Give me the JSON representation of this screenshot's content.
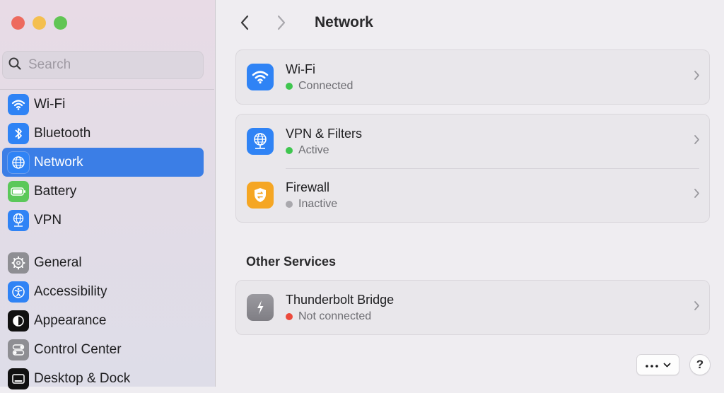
{
  "search": {
    "placeholder": "Search"
  },
  "sidebar": {
    "items": [
      {
        "label": "Wi-Fi"
      },
      {
        "label": "Bluetooth"
      },
      {
        "label": "Network"
      },
      {
        "label": "Battery"
      },
      {
        "label": "VPN"
      },
      {
        "label": "General"
      },
      {
        "label": "Accessibility"
      },
      {
        "label": "Appearance"
      },
      {
        "label": "Control Center"
      },
      {
        "label": "Desktop & Dock"
      }
    ]
  },
  "header": {
    "title": "Network"
  },
  "services": [
    {
      "title": "Wi-Fi",
      "status": "Connected",
      "status_color": "#3fc64f"
    },
    {
      "title": "VPN & Filters",
      "status": "Active",
      "status_color": "#3fc64f"
    },
    {
      "title": "Firewall",
      "status": "Inactive",
      "status_color": "#a9a8ad"
    }
  ],
  "other_services": {
    "heading": "Other Services",
    "items": [
      {
        "title": "Thunderbolt Bridge",
        "status": "Not connected",
        "status_color": "#ec4a3c"
      }
    ]
  },
  "footer": {
    "help_label": "?"
  },
  "colors": {
    "accent": "#3b7ee6",
    "close": "#ed6a5e",
    "minimize": "#f4bf4f",
    "zoom": "#61c554"
  }
}
